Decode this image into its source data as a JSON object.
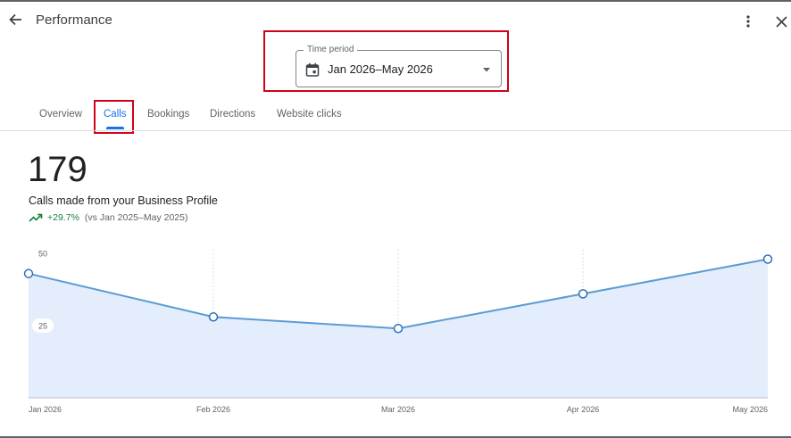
{
  "header": {
    "title": "Performance",
    "back_icon": "arrow-back-icon",
    "more_icon": "more-vert-icon",
    "close_icon": "close-icon"
  },
  "time_period": {
    "label": "Time period",
    "value": "Jan 2026–May 2026",
    "icon": "calendar-icon"
  },
  "tabs": [
    {
      "label": "Overview",
      "active": false
    },
    {
      "label": "Calls",
      "active": true
    },
    {
      "label": "Bookings",
      "active": false
    },
    {
      "label": "Directions",
      "active": false
    },
    {
      "label": "Website clicks",
      "active": false
    }
  ],
  "metric": {
    "value": "179",
    "label": "Calls made from your Business Profile",
    "change": "+29.7%",
    "comparison": "(vs Jan 2025–May 2025)"
  },
  "colors": {
    "highlight": "#d0021b",
    "accent": "#1a73e8",
    "positive": "#188038",
    "line": "#5b9bd5",
    "fill": "#e3edfb"
  },
  "chart_data": {
    "type": "area",
    "x": [
      "Jan 2026",
      "Feb 2026",
      "Mar 2026",
      "Apr 2026",
      "May 2026"
    ],
    "series": [
      {
        "values": [
          43,
          28,
          24,
          36,
          48
        ]
      }
    ],
    "y_ticks": [
      50,
      25
    ],
    "ylim": [
      0,
      50
    ],
    "grid": "vertical-dashed"
  }
}
